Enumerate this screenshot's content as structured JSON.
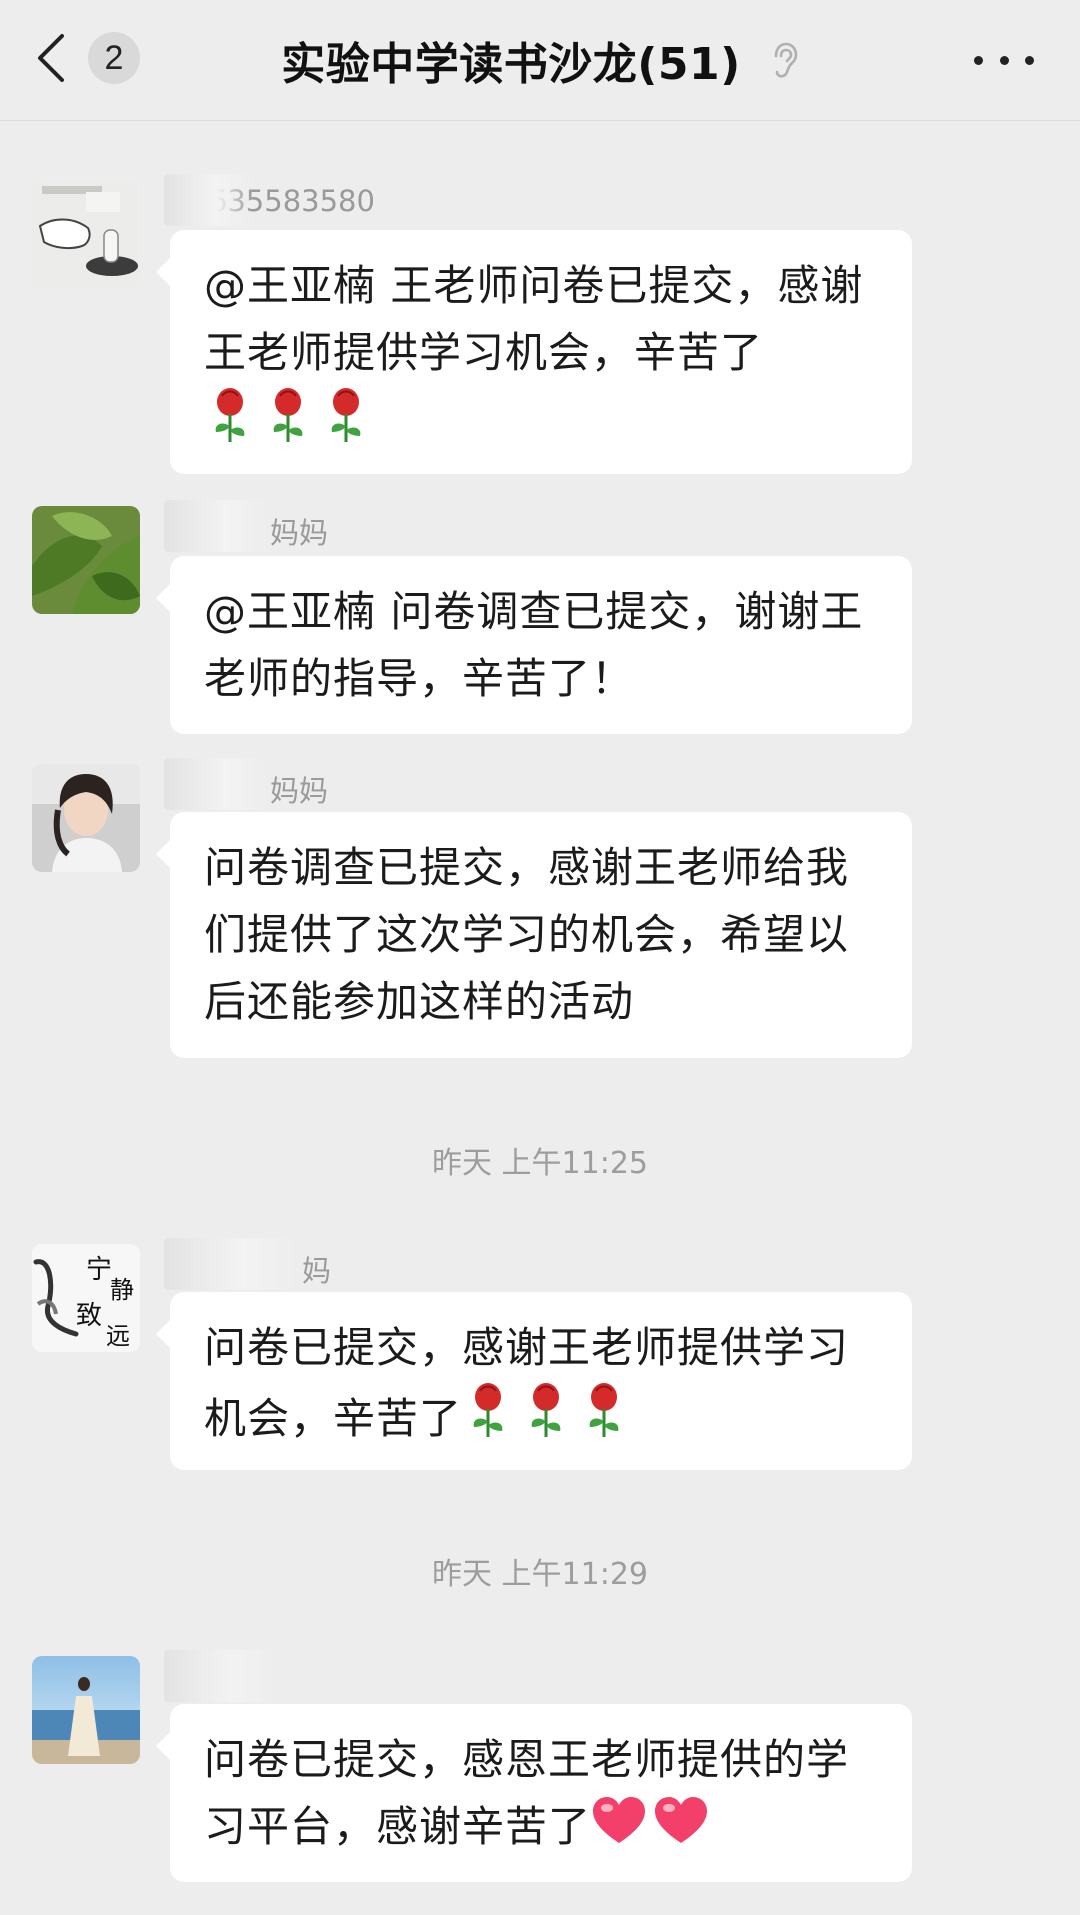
{
  "header": {
    "back_count": "2",
    "title": "实验中学读书沙龙(51)",
    "back_icon": "chevron-left-icon",
    "muted_icon": "ear-icon",
    "more_icon": "more-horizontal-icon"
  },
  "messages": [
    {
      "sender": "13635583580",
      "text": "@王亚楠  王老师问卷已提交，感谢王老师提供学习机会，辛苦了",
      "emoji": "rose-icon"
    },
    {
      "sender": "妈妈",
      "text": "@王亚楠  问卷调查已提交，谢谢王老师的指导，辛苦了！"
    },
    {
      "sender": "妈妈",
      "text": "问卷调查已提交，感谢王老师给我们提供了这次学习的机会，希望以后还能参加这样的活动"
    },
    {
      "sender": "妈",
      "text": "问卷已提交，感谢王老师提供学习机会，辛苦了",
      "emoji": "rose-icon",
      "avatar_text": "宁静致远"
    },
    {
      "sender": "",
      "text": "问卷已提交，感恩王老师提供的学习平台，感谢辛苦了",
      "emoji": "heart-icon"
    }
  ],
  "timestamps": [
    "昨天 上午11:25",
    "昨天 上午11:29"
  ],
  "colors": {
    "background": "#ededed",
    "bubble": "#ffffff",
    "rose": "#d42a2a",
    "heart": "#f2406a"
  }
}
